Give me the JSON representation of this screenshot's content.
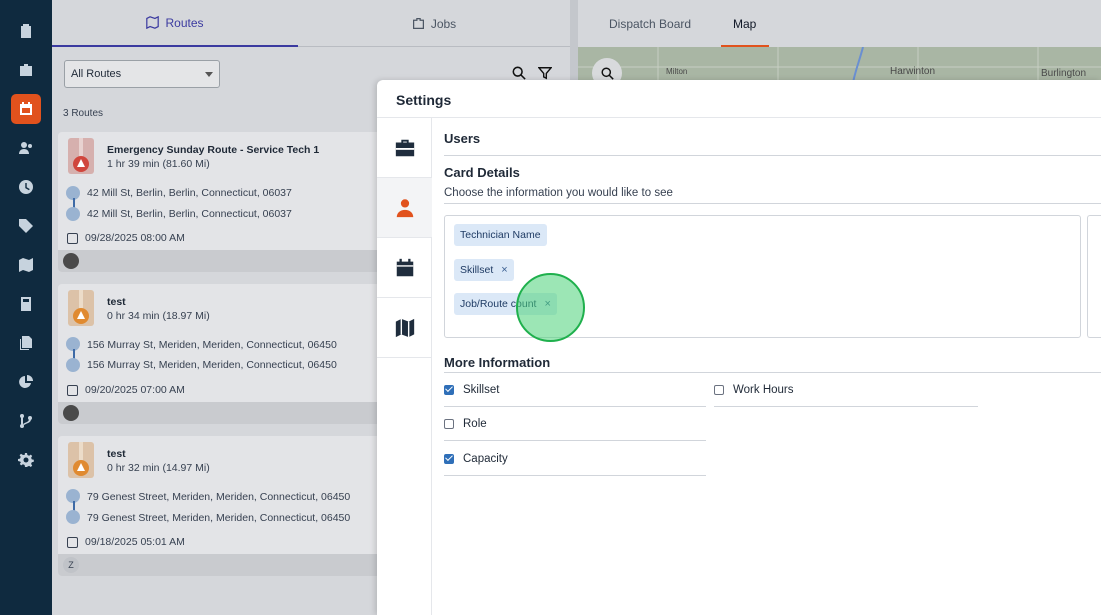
{
  "rail": {
    "icons": [
      "clipboard-icon",
      "briefcase-icon",
      "calendar-icon",
      "users-icon",
      "clock-icon",
      "tag-icon",
      "map-icon",
      "calculator-icon",
      "documents-icon",
      "pie-chart-icon",
      "git-branch-icon",
      "gear-icon"
    ],
    "active": "calendar-icon",
    "accent": "#e1521d"
  },
  "left": {
    "tabs": [
      {
        "label": "Routes"
      },
      {
        "label": "Jobs"
      }
    ],
    "filter_value": "All Routes",
    "routes_count": "3 Routes",
    "routes": [
      {
        "title": "Emergency Sunday Route - Service Tech 1",
        "duration": "1 hr 39 min (81.60 Mi)",
        "start": "42 Mill St, Berlin, Berlin, Connecticut, 06037",
        "end": "42 Mill St, Berlin, Berlin, Connecticut, 06037",
        "date": "09/28/2025 08:00 AM",
        "pin_color": "#d0463d",
        "avatar": ""
      },
      {
        "title": "test",
        "duration": "0 hr 34 min (18.97 Mi)",
        "start": "156 Murray St, Meriden, Meriden, Connecticut, 06450",
        "end": "156 Murray St, Meriden, Meriden, Connecticut, 06450",
        "date": "09/20/2025 07:00 AM",
        "pin_color": "#e08a30",
        "avatar": ""
      },
      {
        "title": "test",
        "duration": "0 hr 32 min (14.97 Mi)",
        "start": "79 Genest Street, Meriden, Meriden, Connecticut, 06450",
        "end": "79 Genest Street, Meriden, Meriden, Connecticut, 06450",
        "date": "09/18/2025 05:01 AM",
        "pin_color": "#e08a30",
        "avatar": "Z"
      }
    ]
  },
  "right": {
    "tabs": [
      {
        "label": "Dispatch Board"
      },
      {
        "label": "Map"
      }
    ],
    "map_labels": [
      "Milton",
      "Harwinton",
      "Burlington"
    ]
  },
  "modal": {
    "title": "Settings",
    "side_icons": [
      "briefcase-icon",
      "user-icon",
      "calendar-icon",
      "map-icon"
    ],
    "active_side": "user-icon",
    "users_title": "Users",
    "card_details_title": "Card Details",
    "card_details_desc": "Choose the information you would like to see",
    "chips": [
      {
        "label": "Technician Name",
        "removable": false
      },
      {
        "label": "Skillset",
        "removable": true,
        "x": "×"
      },
      {
        "label": "Job/Route count",
        "removable": true,
        "x": "×"
      }
    ],
    "more_info_title": "More Information",
    "options_left": [
      {
        "label": "Skillset",
        "checked": true
      },
      {
        "label": "Role",
        "checked": false
      },
      {
        "label": "Capacity",
        "checked": true
      }
    ],
    "options_right": [
      {
        "label": "Work Hours",
        "checked": false
      }
    ]
  }
}
